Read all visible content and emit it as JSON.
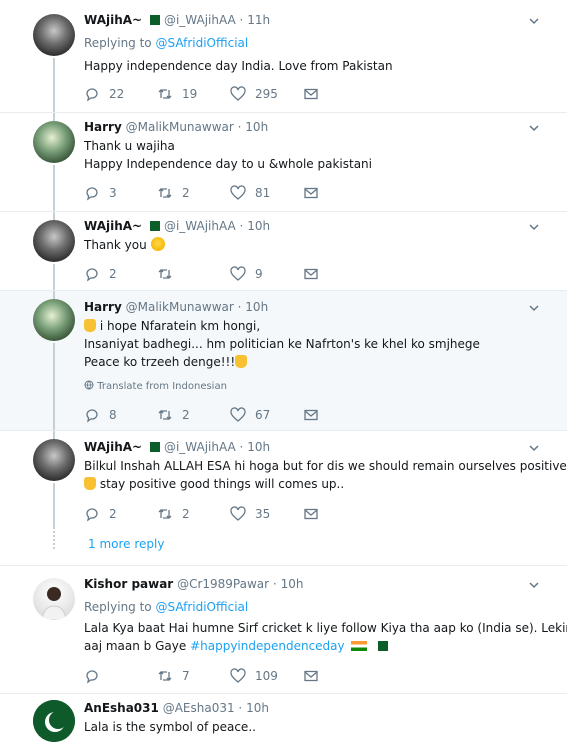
{
  "tweets": [
    {
      "name": "WAjihA~",
      "handle": "@i_WAjihAA",
      "time": "11h",
      "replying_prefix": "Replying to",
      "replying_to": "@SAfridiOfficial",
      "lines": [
        "Happy independence day India. Love from Pakistan"
      ],
      "replies": "22",
      "retweets": "19",
      "likes": "295"
    },
    {
      "name": "Harry",
      "handle": "@MalikMunawwar",
      "time": "10h",
      "lines": [
        "Thank u wajiha",
        "Happy Independence day to u &whole pakistani"
      ],
      "replies": "3",
      "retweets": "2",
      "likes": "81"
    },
    {
      "name": "WAjihA~",
      "handle": "@i_WAjihAA",
      "time": "10h",
      "lines": [
        "Thank you"
      ],
      "replies": "2",
      "retweets": "",
      "likes": "9"
    },
    {
      "name": "Harry",
      "handle": "@MalikMunawwar",
      "time": "10h",
      "lines": [
        "i hope Nfaratein km hongi,",
        "Insaniyat badhegi... hm politician ke Nafrton's ke khel ko smjhege",
        "Peace ko trzeeh denge!!!"
      ],
      "translate": "Translate from Indonesian",
      "replies": "8",
      "retweets": "2",
      "likes": "67"
    },
    {
      "name": "WAjihA~",
      "handle": "@i_WAjihAA",
      "time": "10h",
      "lines": [
        "Bilkul Inshah ALLAH ESA hi hoga but for dis  we should remain ourselves positive..",
        "stay positive good things will comes up.."
      ],
      "replies": "2",
      "retweets": "2",
      "likes": "35"
    },
    {
      "name": "Kishor pawar",
      "handle": "@Cr1989Pawar",
      "time": "10h",
      "replying_prefix": "Replying to",
      "replying_to": "@SAfridiOfficial",
      "lines": [
        "Lala Kya baat Hai humne Sirf  cricket k liye follow Kiya tha aap ko (India se). Lekin"
      ],
      "line2_prefix": "aaj maan b Gaye",
      "hashtag": "#happyindependenceday",
      "replies": "",
      "retweets": "7",
      "likes": "109"
    },
    {
      "name": "AnEsha031",
      "handle": "@AEsha031",
      "time": "10h",
      "lines": [
        "Lala is the symbol of peace.."
      ]
    }
  ],
  "more_reply": "1 more reply",
  "separator_dot": "·",
  "icons": [
    "reply-icon",
    "retweet-icon",
    "like-icon",
    "dm-icon",
    "chevron-down-icon",
    "globe-icon"
  ]
}
